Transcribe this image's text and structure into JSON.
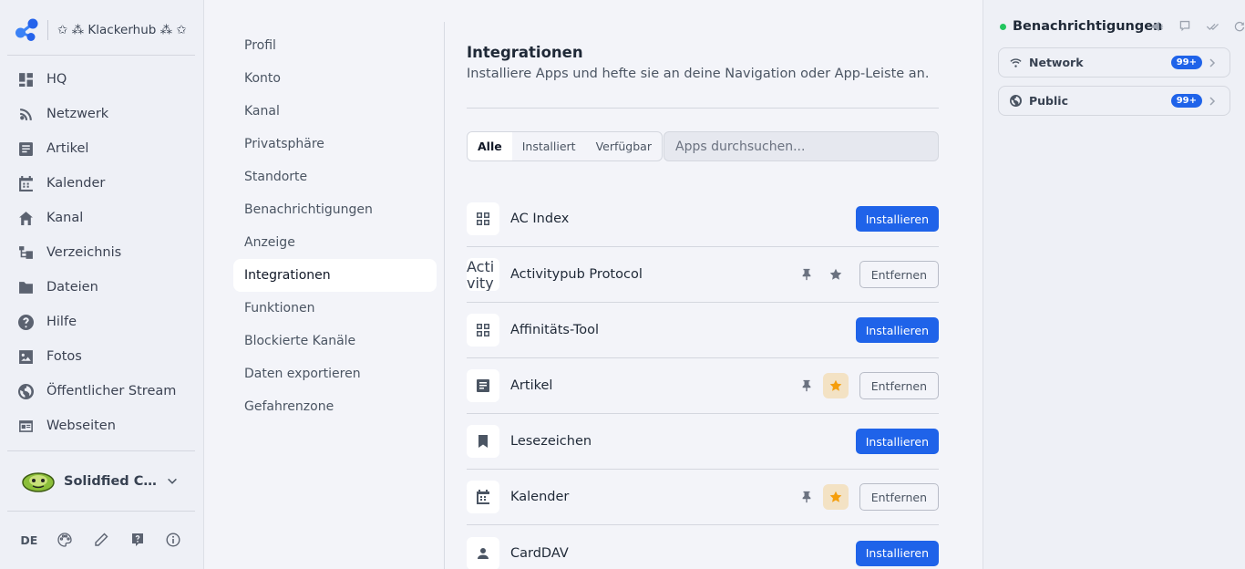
{
  "brand": {
    "name": "✩ ⁂ Klackerhub ⁂ ✩"
  },
  "nav": [
    {
      "id": "hq",
      "label": "HQ"
    },
    {
      "id": "netzwerk",
      "label": "Netzwerk"
    },
    {
      "id": "artikel",
      "label": "Artikel"
    },
    {
      "id": "kalender",
      "label": "Kalender"
    },
    {
      "id": "kanal",
      "label": "Kanal"
    },
    {
      "id": "verzeichnis",
      "label": "Verzeichnis"
    },
    {
      "id": "dateien",
      "label": "Dateien"
    },
    {
      "id": "hilfe",
      "label": "Hilfe"
    },
    {
      "id": "fotos",
      "label": "Fotos"
    },
    {
      "id": "stream",
      "label": "Öffentlicher Stream"
    },
    {
      "id": "webseiten",
      "label": "Webseiten"
    }
  ],
  "profile": {
    "name": "Solidfied Cha..."
  },
  "footer": {
    "language": "DE"
  },
  "settings_menu": [
    {
      "label": "Profil"
    },
    {
      "label": "Konto"
    },
    {
      "label": "Kanal"
    },
    {
      "label": "Privatsphäre"
    },
    {
      "label": "Standorte"
    },
    {
      "label": "Benachrichtigungen"
    },
    {
      "label": "Anzeige"
    },
    {
      "label": "Integrationen",
      "active": true
    },
    {
      "label": "Funktionen"
    },
    {
      "label": "Blockierte Kanäle"
    },
    {
      "label": "Daten exportieren"
    },
    {
      "label": "Gefahrenzone"
    }
  ],
  "content": {
    "title": "Integrationen",
    "subtitle": "Installiere Apps und hefte sie an deine Navigation oder App-Leiste an.",
    "filters": [
      {
        "label": "Alle",
        "active": true
      },
      {
        "label": "Installiert"
      },
      {
        "label": "Verfügbar"
      }
    ],
    "search_placeholder": "Apps durchsuchen...",
    "install_label": "Installieren",
    "remove_label": "Entfernen",
    "apps": [
      {
        "name": "AC Index",
        "icon": "grid-icon",
        "installed": false
      },
      {
        "name": "Activitypub Protocol",
        "icon": "broken-image",
        "icon_alt": "Activitypub Protocol",
        "installed": true,
        "starred": false
      },
      {
        "name": "Affinitäts-Tool",
        "icon": "grid-icon",
        "installed": false
      },
      {
        "name": "Artikel",
        "icon": "article-icon",
        "installed": true,
        "starred": true
      },
      {
        "name": "Lesezeichen",
        "icon": "bookmark-icon",
        "installed": false
      },
      {
        "name": "Kalender",
        "icon": "calendar-icon",
        "installed": true,
        "starred": true
      },
      {
        "name": "CardDAV",
        "icon": "person-icon",
        "installed": false
      }
    ]
  },
  "notifications": {
    "title": "Benachrichtigungen",
    "status_color": "#22c55e",
    "cards": [
      {
        "label": "Network",
        "badge": "99+",
        "icon": "wifi-icon"
      },
      {
        "label": "Public",
        "badge": "99+",
        "icon": "globe-icon"
      }
    ]
  },
  "colors": {
    "accent": "#1f63e9",
    "star": "#f59e0b"
  }
}
